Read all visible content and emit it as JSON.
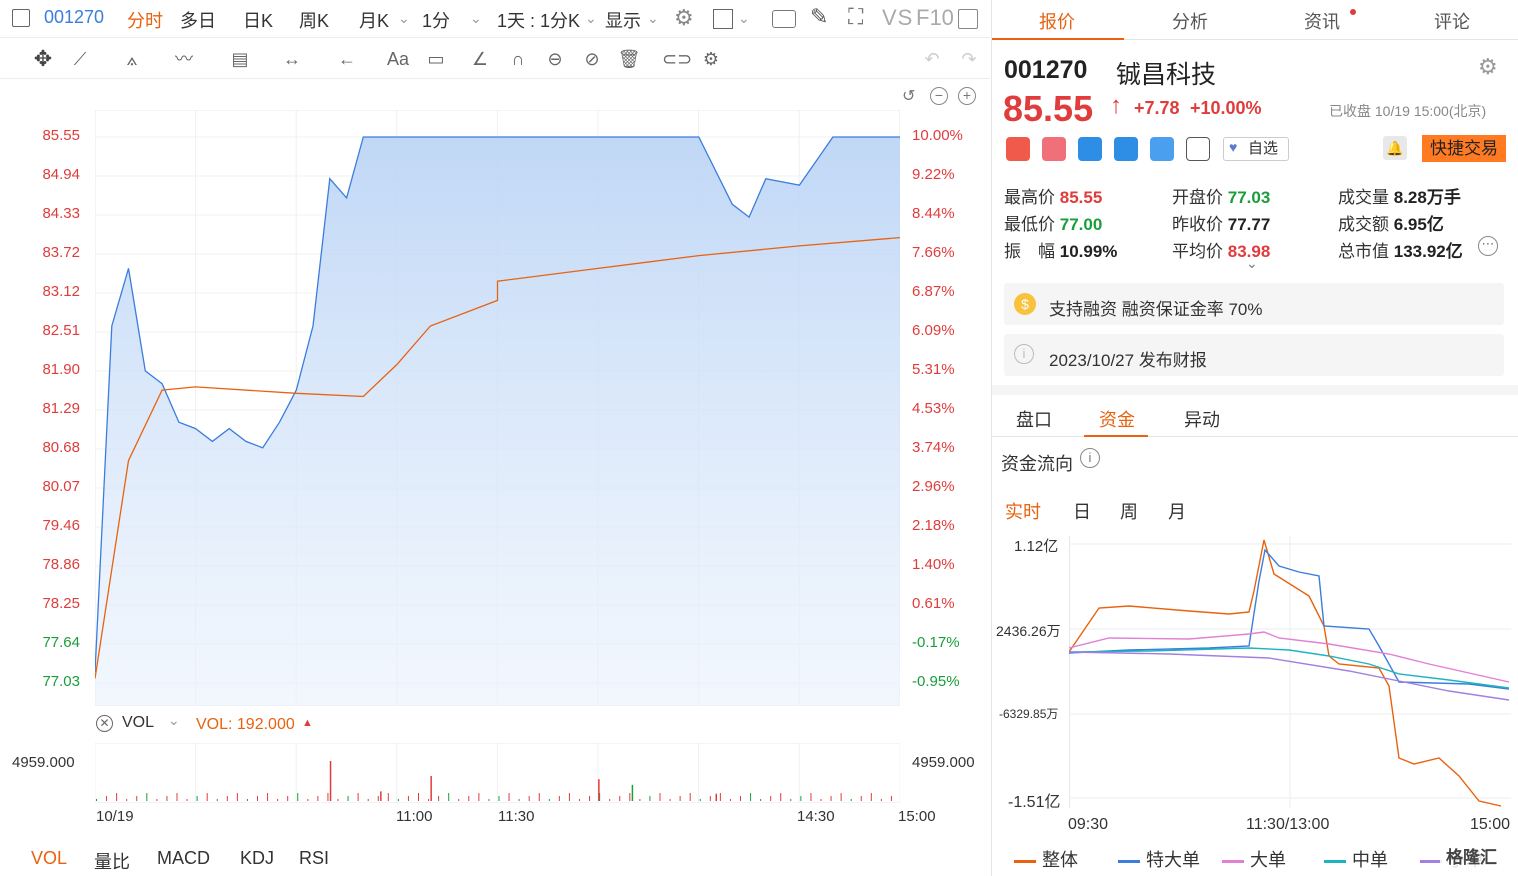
{
  "toolbar": {
    "code": "001270",
    "items": [
      "分时",
      "多日",
      "日K",
      "周K",
      "月K",
      "1分",
      "1天 : 1分K",
      "显示"
    ],
    "vs": "VS",
    "f10": "F10"
  },
  "chart": {
    "left_labels": [
      "85.55",
      "84.94",
      "84.33",
      "83.72",
      "83.12",
      "82.51",
      "81.90",
      "81.29",
      "80.68",
      "80.07",
      "79.46",
      "78.86",
      "78.25",
      "77.64",
      "77.03"
    ],
    "right_labels": [
      "10.00%",
      "9.22%",
      "8.44%",
      "7.66%",
      "6.87%",
      "6.09%",
      "5.31%",
      "4.53%",
      "3.74%",
      "2.96%",
      "2.18%",
      "1.40%",
      "0.61%",
      "-0.17%",
      "-0.95%"
    ],
    "vol_label": "VOL",
    "vol_value": "VOL: 192.000",
    "vol_max_left": "4959.000",
    "vol_max_right": "4959.000",
    "x_labels": [
      "10/19",
      "11:00",
      "11:30",
      "14:30",
      "15:00"
    ],
    "indicators": [
      "VOL",
      "量比",
      "MACD",
      "KDJ",
      "RSI"
    ],
    "accent": "#e8620f",
    "line_color": "#3b7ddd",
    "avg_color": "#e8620f"
  },
  "chart_data": {
    "type": "line",
    "title": "",
    "xlabel": "",
    "ylabel": "",
    "ylim": [
      77.03,
      85.55
    ],
    "series": [
      {
        "name": "",
        "x": [
          "09:30",
          "09:35",
          "09:40",
          "09:45",
          "09:50",
          "09:55",
          "10:00",
          "10:05",
          "10:10",
          "10:15",
          "10:20",
          "10:25",
          "10:30",
          "10:35",
          "10:40",
          "10:45",
          "10:50",
          "10:55",
          "11:00",
          "11:05",
          "11:10",
          "11:15",
          "11:20",
          "11:25",
          "11:30",
          "13:00",
          "13:30",
          "14:00",
          "14:10",
          "14:15",
          "14:20",
          "14:30",
          "14:40",
          "14:50",
          "15:00"
        ],
        "values": [
          77.2,
          82.6,
          83.5,
          81.9,
          81.7,
          81.1,
          81.0,
          80.8,
          81.0,
          80.8,
          80.7,
          81.1,
          81.6,
          82.6,
          84.9,
          84.6,
          85.55,
          85.55,
          85.55,
          85.55,
          85.55,
          85.55,
          85.55,
          85.55,
          85.55,
          85.55,
          85.55,
          85.55,
          84.5,
          84.3,
          84.9,
          84.8,
          85.55,
          85.55,
          85.55
        ]
      },
      {
        "name": "",
        "x": [
          "09:30",
          "09:40",
          "09:50",
          "10:00",
          "10:30",
          "10:50",
          "11:00",
          "11:10",
          "11:30",
          "13:00",
          "13:30",
          "14:00",
          "14:30",
          "15:00"
        ],
        "values": [
          77.1,
          80.5,
          81.6,
          81.65,
          81.55,
          81.5,
          82.0,
          82.6,
          83.0,
          83.3,
          83.5,
          83.7,
          83.85,
          83.98
        ]
      }
    ],
    "volume": {
      "x": [
        "10:40",
        "10:55",
        "11:10",
        "13:30",
        "13:40",
        "14:05"
      ],
      "values": [
        4959,
        1200,
        3100,
        2700,
        2000,
        900
      ]
    }
  },
  "stock": {
    "code": "001270",
    "name": "铖昌科技",
    "price": "85.55",
    "change": "+7.78",
    "change_pct": "+10.00%",
    "status": "已收盘 10/19 15:00(北京)",
    "watch_label": "自选",
    "trade_label": "快捷交易",
    "stats": [
      {
        "label": "最高价",
        "value": "85.55",
        "color": "red"
      },
      {
        "label": "开盘价",
        "value": "77.03",
        "color": "green"
      },
      {
        "label": "成交量",
        "value": "8.28万手",
        "color": "black"
      },
      {
        "label": "最低价",
        "value": "77.00",
        "color": "green"
      },
      {
        "label": "昨收价",
        "value": "77.77",
        "color": "black"
      },
      {
        "label": "成交额",
        "value": "6.95亿",
        "color": "black"
      },
      {
        "label": "振　幅",
        "value": "10.99%",
        "color": "black"
      },
      {
        "label": "平均价",
        "value": "83.98",
        "color": "red"
      },
      {
        "label": "总市值",
        "value": "133.92亿",
        "color": "black"
      }
    ],
    "margin_note": "支持融资 融资保证金率 70%",
    "report_note": "2023/10/27  发布财报"
  },
  "right_tabs": [
    "报价",
    "分析",
    "资讯",
    "评论"
  ],
  "sub_tabs": [
    "盘口",
    "资金",
    "异动"
  ],
  "flow": {
    "title": "资金流向",
    "periods": [
      "实时",
      "日",
      "周",
      "月"
    ],
    "y_labels": [
      "1.12亿",
      "2436.26万",
      "-6329.85万",
      "-1.51亿"
    ],
    "x_labels": [
      "09:30",
      "11:30/13:00",
      "15:00"
    ],
    "legend": [
      {
        "name": "整体",
        "color": "#e8620f"
      },
      {
        "name": "特大单",
        "color": "#3b7ddd"
      },
      {
        "name": "大单",
        "color": "#e27fd6"
      },
      {
        "name": "中单",
        "color": "#1fb3c0"
      },
      {
        "name": "小单",
        "color": "#a27fe0"
      }
    ],
    "watermark": "格隆汇"
  }
}
